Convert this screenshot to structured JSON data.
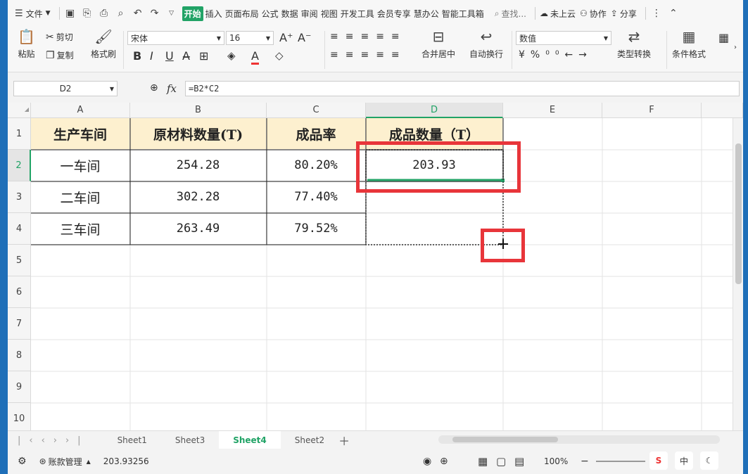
{
  "menubar": {
    "file_label": "文件",
    "tabs": [
      "开始",
      "插入",
      "页面布局",
      "公式",
      "数据",
      "审阅",
      "视图",
      "开发工具",
      "会员专享",
      "慧办公",
      "智能工具箱"
    ],
    "search_label": "查找...",
    "cloud_label": "未上云",
    "collab_label": "协作",
    "share_label": "分享"
  },
  "ribbon": {
    "paste_label": "粘贴",
    "cut_label": "剪切",
    "copy_label": "复制",
    "format_painter_label": "格式刷",
    "font_name": "宋体",
    "font_size": "16",
    "merge_label": "合并居中",
    "wrap_label": "自动换行",
    "number_format": "数值",
    "type_convert_label": "类型转换",
    "cond_format_label": "条件格式"
  },
  "formula_bar": {
    "name_box": "D2",
    "fx_label": "fx",
    "formula": "=B2*C2"
  },
  "columns": [
    "A",
    "B",
    "C",
    "D",
    "E",
    "F"
  ],
  "rows": [
    "1",
    "2",
    "3",
    "4",
    "5",
    "6",
    "7",
    "8",
    "9",
    "10"
  ],
  "table": {
    "headers": [
      "生产车间",
      "原材料数量(T)",
      "成品率",
      "成品数量（T）"
    ],
    "data": [
      [
        "一车间",
        "254.28",
        "80.20%",
        "203.93"
      ],
      [
        "二车间",
        "302.28",
        "77.40%",
        ""
      ],
      [
        "三车间",
        "263.49",
        "79.52%",
        ""
      ]
    ]
  },
  "sheets": [
    "Sheet1",
    "Sheet3",
    "Sheet4",
    "Sheet2"
  ],
  "active_sheet": "Sheet4",
  "status": {
    "account_label": "账款管理",
    "sum_value": "203.93256",
    "zoom": "100%",
    "ime_label": "中"
  },
  "colors": {
    "accent": "#21a366",
    "header_fill": "#fdf0cf",
    "highlight": "#e8353a"
  }
}
